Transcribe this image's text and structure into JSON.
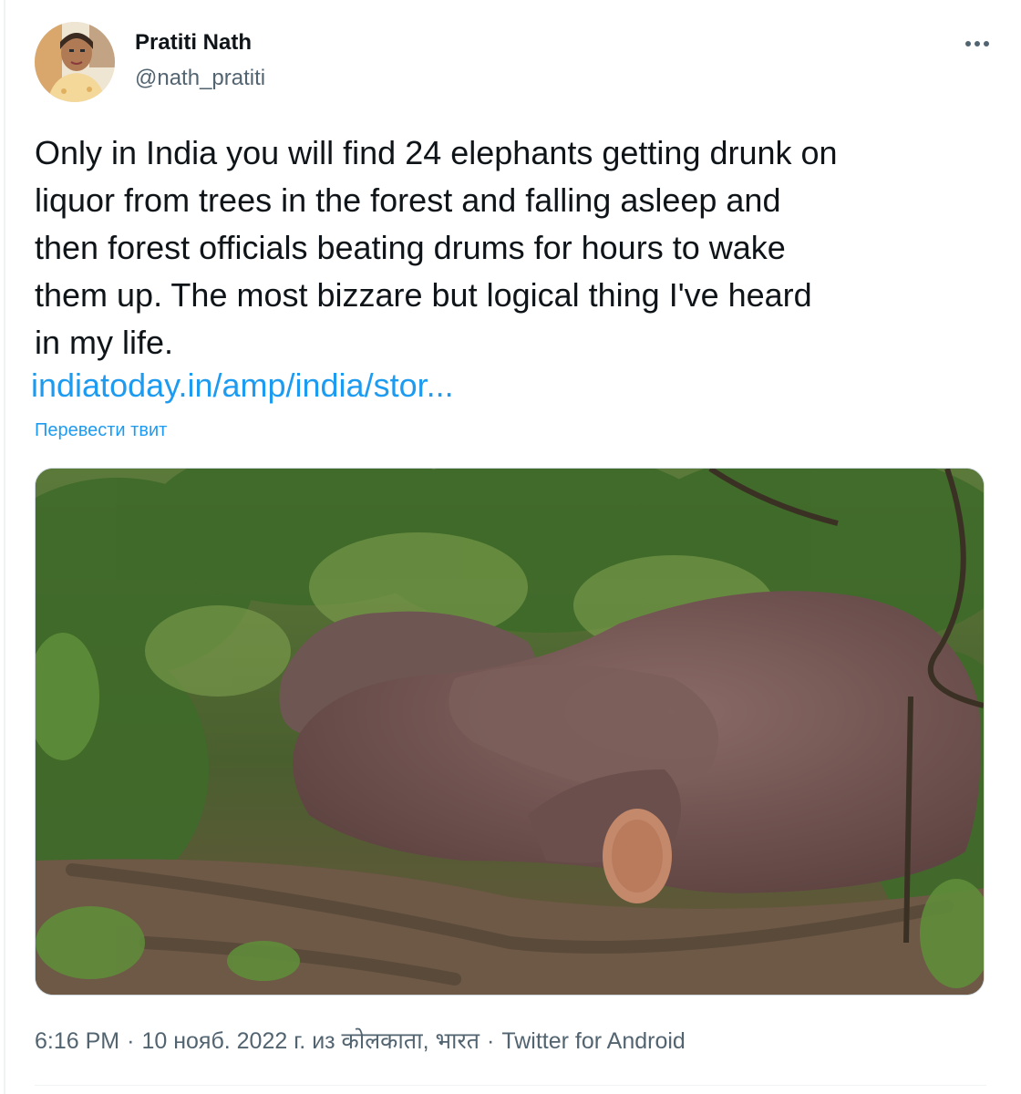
{
  "author": {
    "name": "Pratiti Nath",
    "handle": "@nath_pratiti"
  },
  "tweet": {
    "text": "Only in India you will find 24 elephants getting drunk on\nliquor from trees in the forest and falling asleep and\nthen forest officials beating drums for hours to wake\nthem up. The most bizzare but logical thing I've heard\nin my life.",
    "link": "indiatoday.in/amp/india/stor...",
    "translate": "Перевести твит"
  },
  "meta": {
    "time": "6:16 PM",
    "date": "10 нояб. 2022 г.",
    "location": "из कोलकाता, भारत",
    "source": "Twitter for Android",
    "separator": "·"
  },
  "icons": {
    "more": "more-horizontal-icon"
  },
  "colors": {
    "text": "#0f1419",
    "secondary": "#536471",
    "link": "#1d9bf0"
  }
}
